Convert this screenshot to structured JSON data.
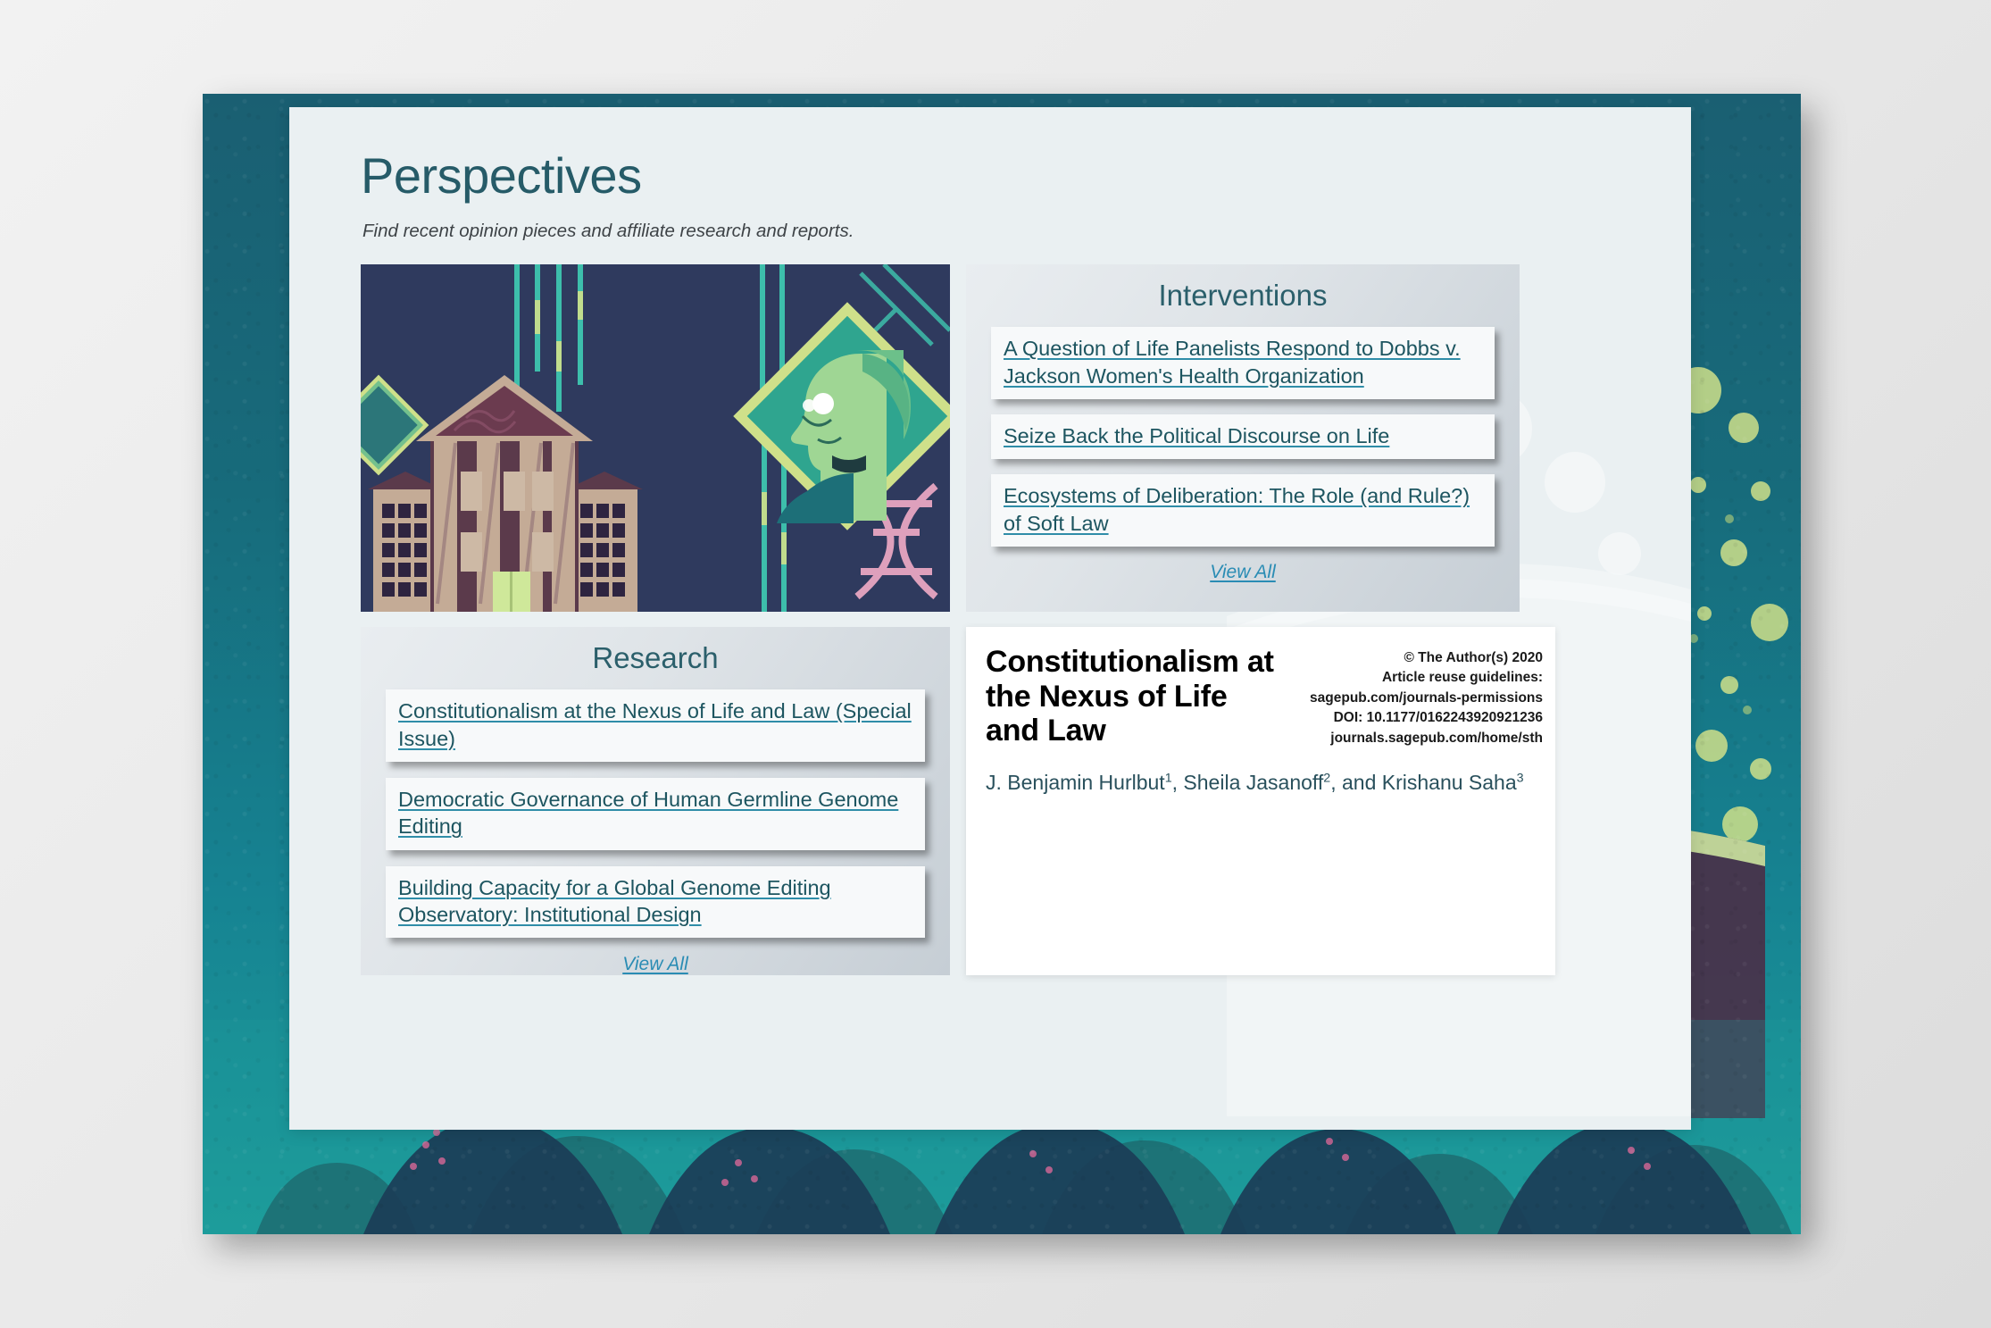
{
  "page": {
    "title": "Perspectives",
    "subtitle": "Find recent opinion pieces and affiliate research and reports."
  },
  "hero": {
    "alt": "courthouse-illustration"
  },
  "interventions": {
    "title": "Interventions",
    "items": [
      {
        "label": "A Question of Life Panelists Respond to Dobbs v. Jackson Women's Health Organization"
      },
      {
        "label": "Seize Back the Political Discourse on Life"
      },
      {
        "label": "Ecosystems of Deliberation: The Role (and Rule?) of Soft Law"
      }
    ],
    "view_all": "View All"
  },
  "research": {
    "title": "Research",
    "items": [
      {
        "label": "Constitutionalism at the Nexus of Life and Law (Special Issue)"
      },
      {
        "label": "Democratic Governance of Human Germline Genome Editing"
      },
      {
        "label": "Building Capacity for a Global Genome Editing Observatory: Institutional Design"
      }
    ],
    "view_all": "View All"
  },
  "article": {
    "title": "Constitutionalism at the Nexus of Life and Law",
    "meta": [
      "© The Author(s) 2020",
      "Article reuse guidelines:",
      "sagepub.com/journals-permissions",
      "DOI: 10.1177/0162243920921236",
      "journals.sagepub.com/home/sth"
    ],
    "authors_parts": [
      {
        "text": "J. Benjamin Hurlbut",
        "sup": "1"
      },
      {
        "text": ", Sheila Jasanoff",
        "sup": "2"
      },
      {
        "text": ", and Krishanu Saha",
        "sup": "3"
      }
    ]
  },
  "colors": {
    "frame_teal": "#176b7b",
    "card_bg": "#eaf0f2",
    "heading_teal": "#265b68",
    "link_teal": "#1d5560",
    "link_underline": "#2f8da8",
    "view_all": "#2a8cb4",
    "hero_navy": "#2f3a5e"
  }
}
